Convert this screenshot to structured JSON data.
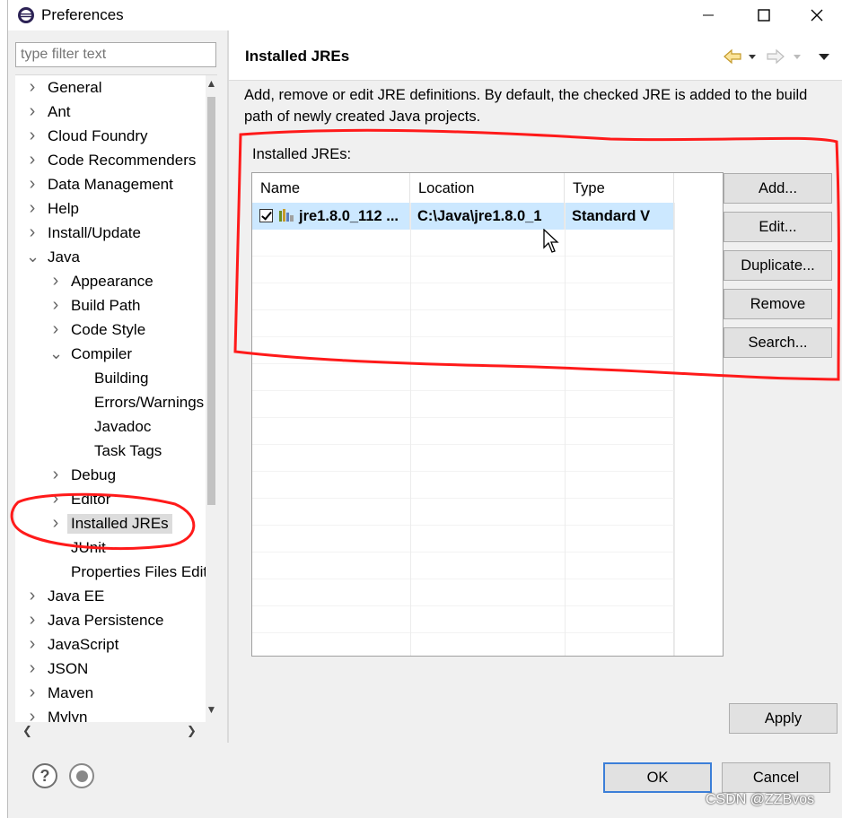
{
  "window": {
    "title": "Preferences",
    "icons": {
      "app": "eclipse-icon",
      "minimize": "minimize-icon",
      "maximize": "maximize-icon",
      "close": "close-icon"
    }
  },
  "sidebar": {
    "filter_placeholder": "type filter text",
    "items": [
      {
        "label": "General",
        "expander": "collapsed"
      },
      {
        "label": "Ant",
        "expander": "collapsed"
      },
      {
        "label": "Cloud Foundry",
        "expander": "collapsed"
      },
      {
        "label": "Code Recommenders",
        "expander": "collapsed"
      },
      {
        "label": "Data Management",
        "expander": "collapsed"
      },
      {
        "label": "Help",
        "expander": "collapsed"
      },
      {
        "label": "Install/Update",
        "expander": "collapsed"
      },
      {
        "label": "Java",
        "expander": "expanded"
      },
      {
        "label": "Appearance",
        "expander": "collapsed"
      },
      {
        "label": "Build Path",
        "expander": "collapsed"
      },
      {
        "label": "Code Style",
        "expander": "collapsed"
      },
      {
        "label": "Compiler",
        "expander": "expanded"
      },
      {
        "label": "Building",
        "expander": "none"
      },
      {
        "label": "Errors/Warnings",
        "expander": "none"
      },
      {
        "label": "Javadoc",
        "expander": "none"
      },
      {
        "label": "Task Tags",
        "expander": "none"
      },
      {
        "label": "Debug",
        "expander": "collapsed"
      },
      {
        "label": "Editor",
        "expander": "collapsed"
      },
      {
        "label": "Installed JREs",
        "expander": "collapsed",
        "selected": true
      },
      {
        "label": "JUnit",
        "expander": "none"
      },
      {
        "label": "Properties Files Editor",
        "expander": "none"
      },
      {
        "label": "Java EE",
        "expander": "collapsed"
      },
      {
        "label": "Java Persistence",
        "expander": "collapsed"
      },
      {
        "label": "JavaScript",
        "expander": "collapsed"
      },
      {
        "label": "JSON",
        "expander": "collapsed"
      },
      {
        "label": "Maven",
        "expander": "collapsed"
      },
      {
        "label": "Mylyn",
        "expander": "collapsed"
      }
    ]
  },
  "page": {
    "title": "Installed JREs",
    "description": "Add, remove or edit JRE definitions. By default, the checked JRE is added to the build path of newly created Java projects.",
    "group_label": "Installed JREs:",
    "nav_icons": [
      "back-arrow-icon",
      "dropdown-icon",
      "forward-arrow-icon",
      "dropdown-icon",
      "menu-icon"
    ]
  },
  "table": {
    "columns": [
      "Name",
      "Location",
      "Type"
    ],
    "rows": [
      {
        "checked": true,
        "name": "jre1.8.0_112 ...",
        "location": "C:\\Java\\jre1.8.0_1",
        "type": "Standard V"
      }
    ]
  },
  "buttons": {
    "add": "Add...",
    "edit": "Edit...",
    "duplicate": "Duplicate...",
    "remove": "Remove",
    "search": "Search...",
    "apply": "Apply",
    "ok": "OK",
    "cancel": "Cancel"
  },
  "watermark": "CSDN @ZZBvos",
  "colors": {
    "selection": "#cce8ff",
    "annotation": "#ff0000",
    "default_button_border": "#3c7fd8"
  }
}
